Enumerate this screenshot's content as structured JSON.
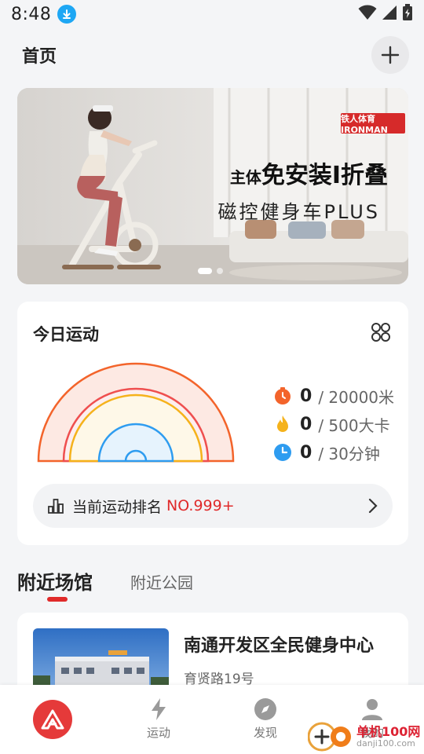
{
  "status_bar": {
    "time": "8:48"
  },
  "header": {
    "title": "首页"
  },
  "banner": {
    "brand": "铁人体育 IRONMAN",
    "headline_prefix": "主体",
    "headline_main": "免安装I折叠",
    "subline": "磁控健身车PLUS",
    "slide_count": 2,
    "active_slide": 1
  },
  "today": {
    "title": "今日运动",
    "stats": [
      {
        "icon": "timer-icon",
        "value": "0",
        "goal": "/ 20000米",
        "color": "#f3642b"
      },
      {
        "icon": "flame-icon",
        "value": "0",
        "goal": "/ 500大卡",
        "color": "#f5b21b"
      },
      {
        "icon": "clock-icon",
        "value": "0",
        "goal": "/ 30分钟",
        "color": "#2e9cf0"
      }
    ],
    "ranking": {
      "label": "当前运动排名",
      "value": "NO.999+"
    }
  },
  "tabs": {
    "active": "附近场馆",
    "inactive": "附近公园"
  },
  "venue": {
    "name": "南通开发区全民健身中心",
    "address": "育贤路19号"
  },
  "bottom_nav": {
    "items": [
      {
        "label": "运动"
      },
      {
        "label": "发现"
      },
      {
        "label": "我的"
      }
    ]
  },
  "watermark": {
    "text": "单机100网",
    "url": "danji100.com"
  },
  "colors": {
    "accent": "#e02a2a",
    "ring_orange": "#f3642b",
    "ring_red": "#ef4f4f",
    "ring_yellow": "#f5b21b",
    "ring_blue": "#2e9cf0"
  }
}
